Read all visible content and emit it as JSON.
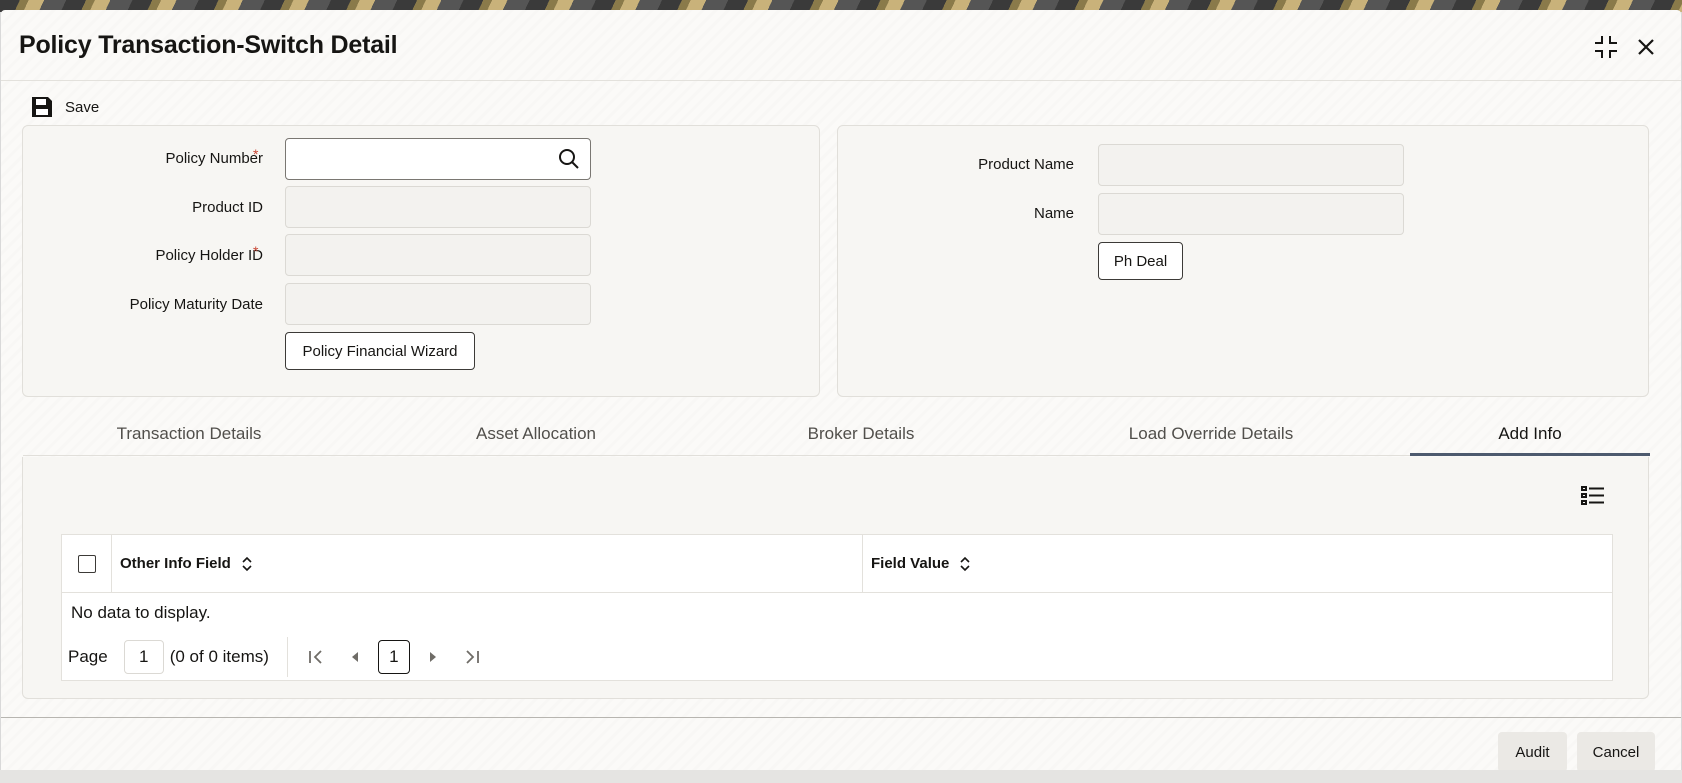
{
  "window": {
    "title": "Policy Transaction-Switch Detail"
  },
  "toolbar": {
    "save_label": "Save"
  },
  "left_panel": {
    "policy_number_label": "Policy Number",
    "policy_number_value": "",
    "product_id_label": "Product ID",
    "product_id_value": "",
    "policy_holder_id_label": "Policy Holder ID",
    "policy_holder_id_value": "",
    "policy_maturity_date_label": "Policy Maturity Date",
    "policy_maturity_date_value": "",
    "wizard_button": "Policy Financial Wizard",
    "required_mark": "*"
  },
  "right_panel": {
    "product_name_label": "Product Name",
    "product_name_value": "",
    "name_label": "Name",
    "name_value": "",
    "ph_deal_button": "Ph Deal"
  },
  "tabs": [
    {
      "label": "Transaction Details",
      "active": false
    },
    {
      "label": "Asset Allocation",
      "active": false
    },
    {
      "label": "Broker Details",
      "active": false
    },
    {
      "label": "Load Override Details",
      "active": false
    },
    {
      "label": "Add Info",
      "active": true
    }
  ],
  "table": {
    "columns": [
      "Other Info Field",
      "Field Value"
    ],
    "empty_message": "No data to display.",
    "pager": {
      "page_label": "Page",
      "page_value": "1",
      "items_text": "(0 of 0 items)",
      "current_page": "1"
    }
  },
  "footer": {
    "audit_label": "Audit",
    "cancel_label": "Cancel"
  },
  "colors": {
    "required": "#c74634",
    "tab_underline": "#4d5a6e",
    "panel_bg": "#f7f6f3"
  },
  "icons": [
    "maximize-icon",
    "close-icon",
    "save-icon",
    "search-icon",
    "column-list-icon",
    "sort-icon",
    "first-page-icon",
    "prev-page-icon",
    "next-page-icon",
    "last-page-icon"
  ]
}
